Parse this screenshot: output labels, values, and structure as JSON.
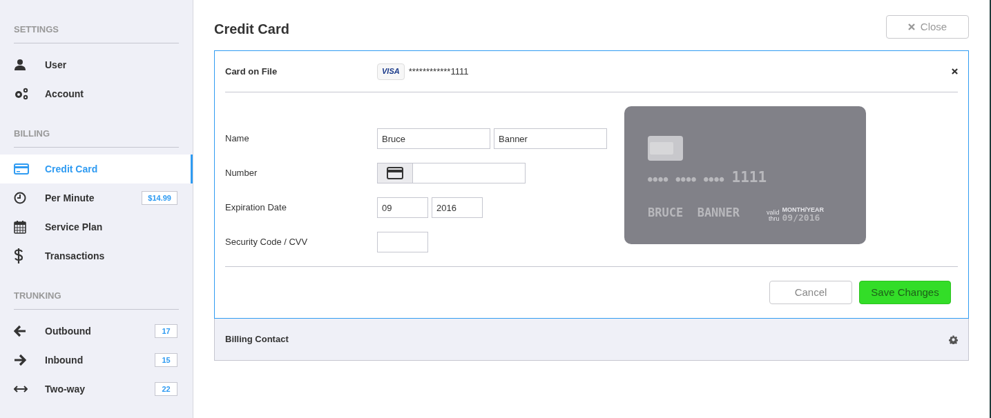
{
  "sidebar": {
    "sections": [
      {
        "heading": "SETTINGS",
        "items": [
          {
            "label": "User",
            "selected": false
          },
          {
            "label": "Account",
            "selected": false
          }
        ]
      },
      {
        "heading": "BILLING",
        "items": [
          {
            "label": "Credit Card",
            "selected": true
          },
          {
            "label": "Per Minute",
            "selected": false,
            "badge": "$14.99"
          },
          {
            "label": "Service Plan",
            "selected": false
          },
          {
            "label": "Transactions",
            "selected": false
          }
        ]
      },
      {
        "heading": "TRUNKING",
        "items": [
          {
            "label": "Outbound",
            "selected": false,
            "badge": "17"
          },
          {
            "label": "Inbound",
            "selected": false,
            "badge": "15"
          },
          {
            "label": "Two-way",
            "selected": false,
            "badge": "22"
          }
        ]
      }
    ]
  },
  "page": {
    "title": "Credit Card",
    "close_button": "Close"
  },
  "panels": [
    {
      "title": "Card on File",
      "expanded": true,
      "card_brand": "VISA",
      "masked_number": "************1111",
      "form": [
        {
          "kind": "pair",
          "label": "Name",
          "fields": [
            "Bruce",
            "Banner"
          ]
        },
        {
          "kind": "card_number",
          "label": "Number"
        },
        {
          "kind": "pair",
          "label": "Expiration Date",
          "fields": [
            "09",
            "2016"
          ]
        },
        {
          "kind": "short",
          "label": "Security Code / CVV"
        }
      ],
      "card_preview": {
        "dots": [
          "●●●●",
          "●●●●",
          "●●●●"
        ],
        "last_four": "1111",
        "holder": "BRUCE  BANNER",
        "valid": "valid",
        "thru": "thru",
        "month_year": "MONTH/YEAR",
        "expiry": "09/2016"
      },
      "buttons": {
        "cancel": "Cancel",
        "save": "Save Changes"
      }
    },
    {
      "title": "Billing Contact",
      "expanded": false
    }
  ]
}
